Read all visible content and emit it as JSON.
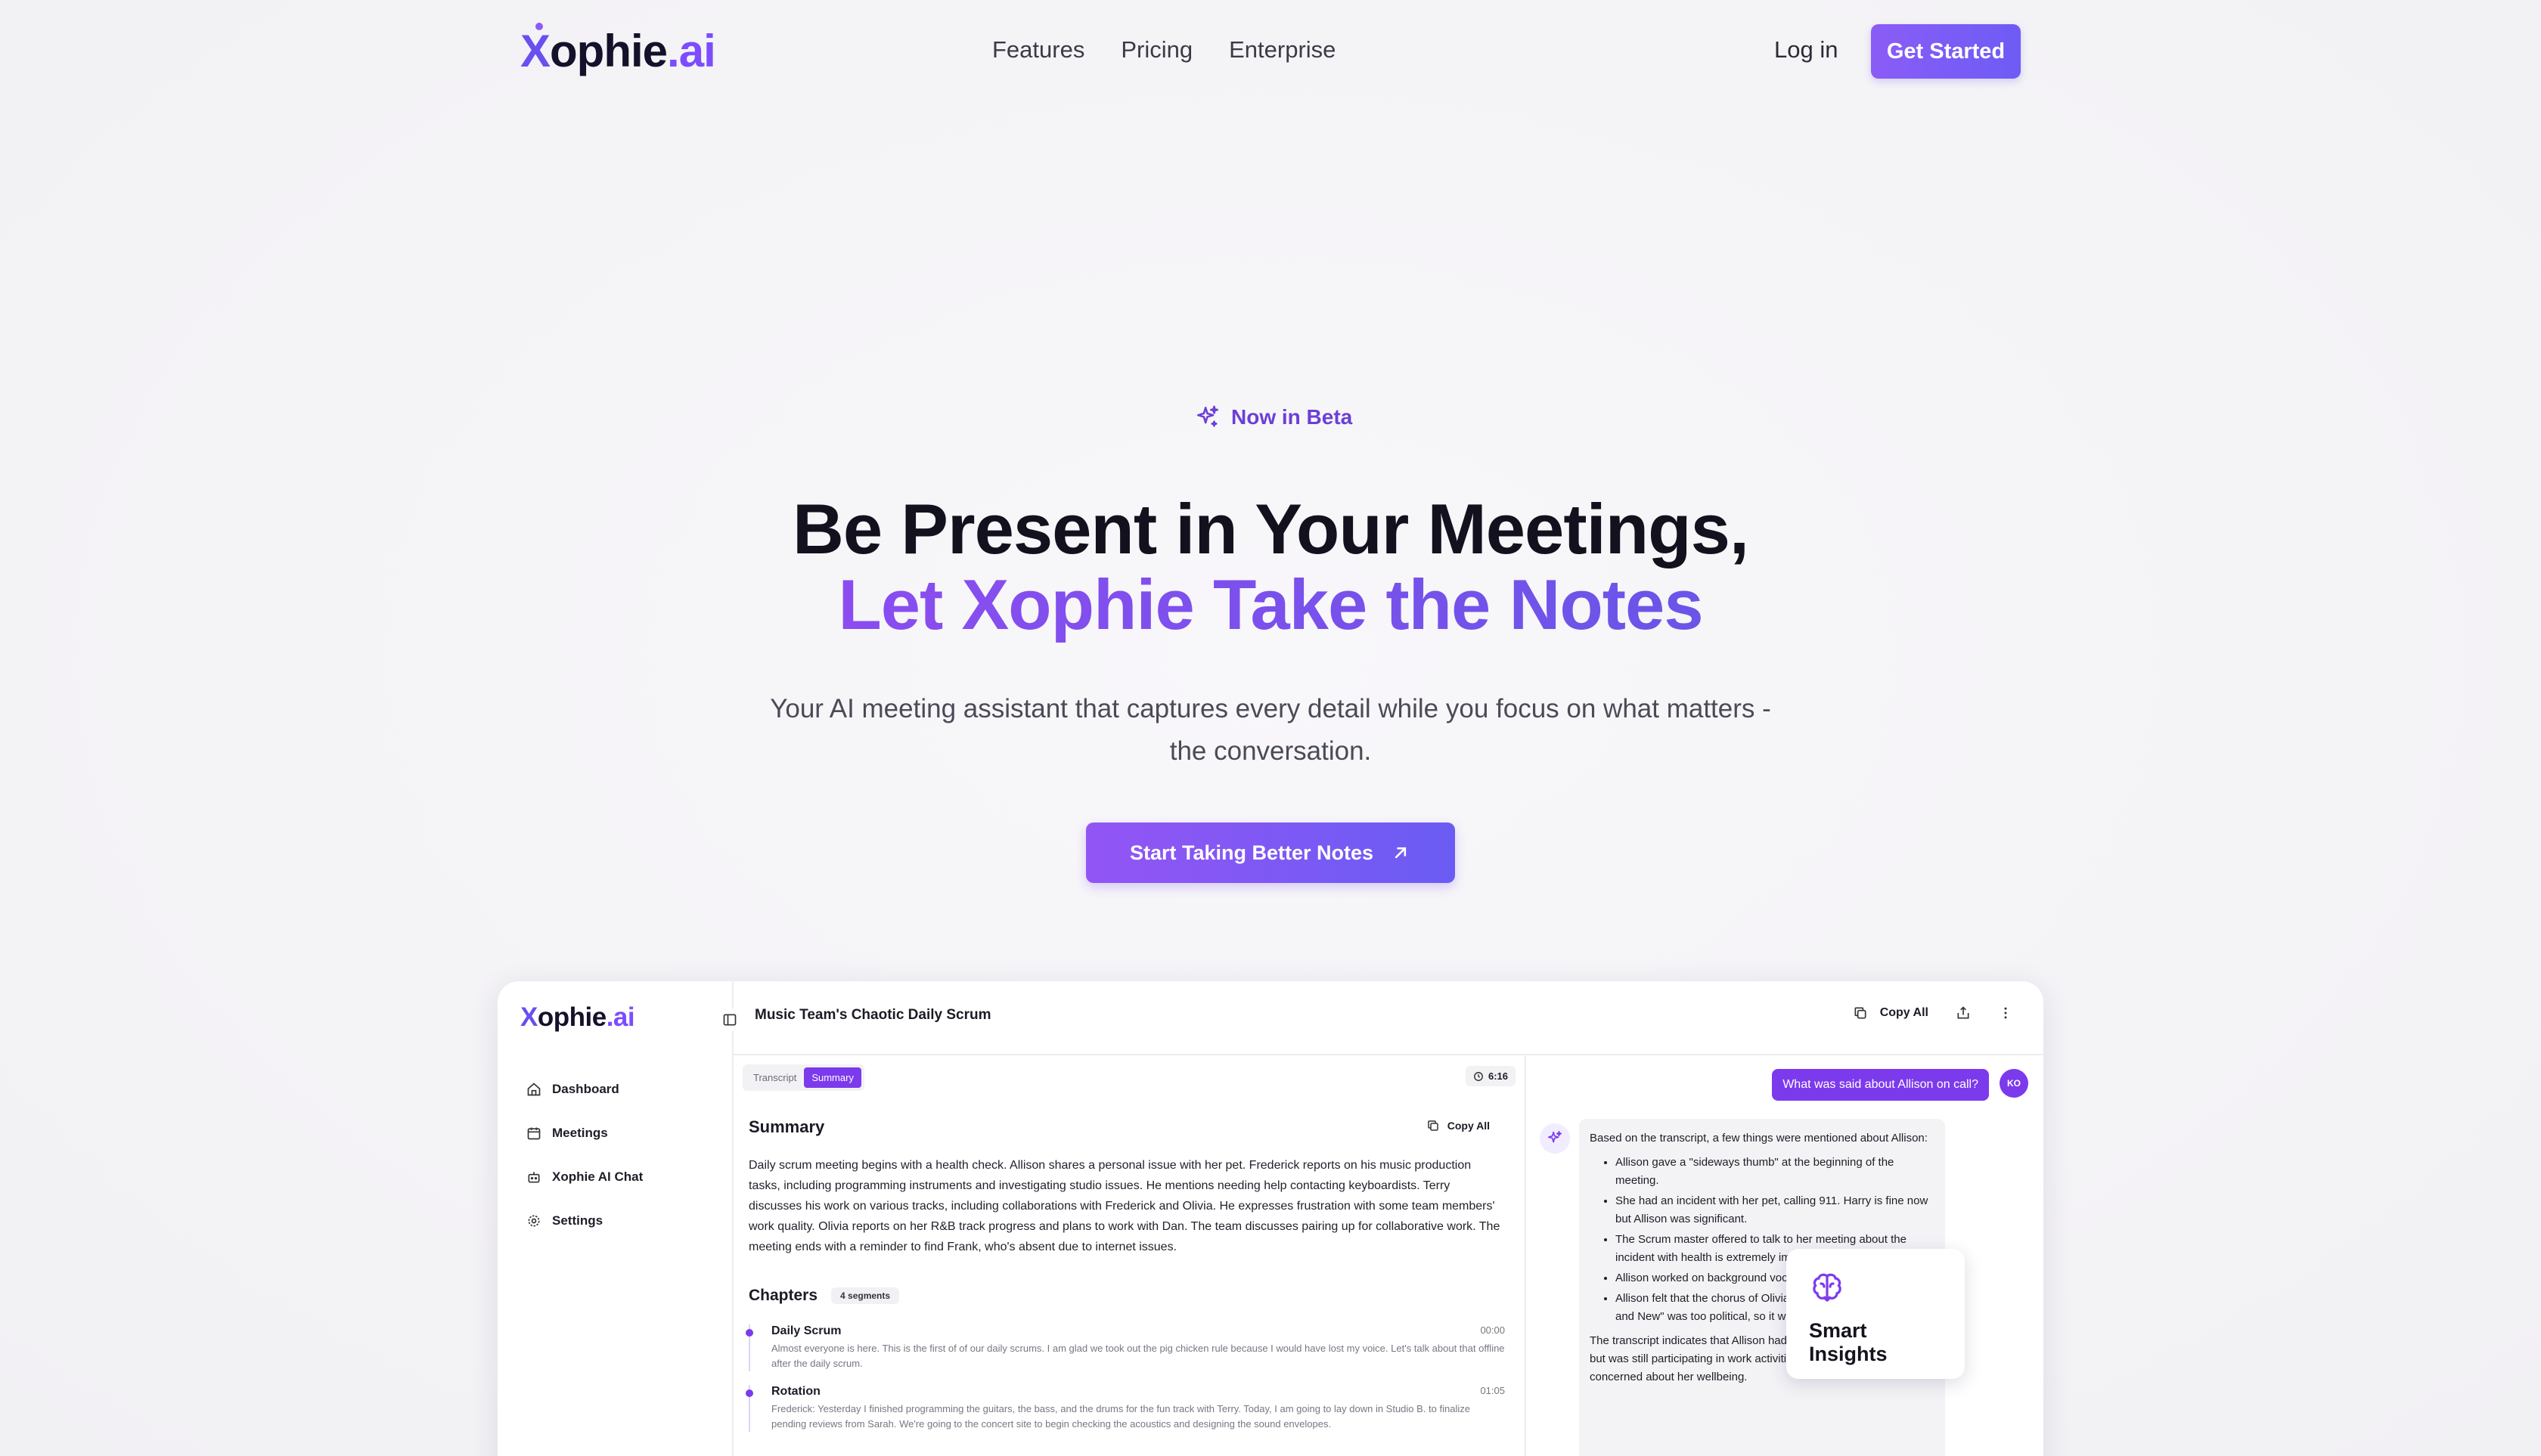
{
  "nav": {
    "logo_x": "X",
    "logo_rest": "ophie",
    "logo_dot": ".ai",
    "links": [
      "Features",
      "Pricing",
      "Enterprise"
    ],
    "login": "Log in",
    "cta": "Get Started"
  },
  "hero": {
    "badge": "Now in Beta",
    "title_line1": "Be Present in Your Meetings,",
    "title_line2": "Let Xophie Take the Notes",
    "subtitle": "Your AI meeting assistant that captures every detail while you focus on what matters - the conversation.",
    "cta": "Start Taking Better Notes"
  },
  "app": {
    "logo_x": "X",
    "logo_rest": "ophie",
    "logo_dot": ".ai",
    "sidebar": [
      "Dashboard",
      "Meetings",
      "Xophie AI Chat",
      "Settings"
    ],
    "meeting_title": "Music Team's Chaotic Daily Scrum",
    "copy_all": "Copy All",
    "tabs": [
      "Transcript",
      "Summary"
    ],
    "active_tab": "Summary",
    "duration": "6:16",
    "summary_title": "Summary",
    "summary_copy": "Copy All",
    "summary_text": "Daily scrum meeting begins with a health check. Allison shares a personal issue with her pet. Frederick reports on his music production tasks, including programming instruments and investigating studio issues. He mentions needing help contacting keyboardists. Terry discusses his work on various tracks, including collaborations with Frederick and Olivia. He expresses frustration with some team members' work quality. Olivia reports on her R&B track progress and plans to work with Dan. The team discusses pairing up for collaborative work. The meeting ends with a reminder to find Frank, who's absent due to internet issues.",
    "chapters_title": "Chapters",
    "chapters_badge": "4 segments",
    "chapters": [
      {
        "name": "Daily Scrum",
        "time": "00:00",
        "text": "Almost everyone is here. This is the first of of our daily scrums. I am glad we took out the pig chicken rule because I would have lost my voice. Let's talk about that offline after the daily scrum."
      },
      {
        "name": "Rotation",
        "time": "01:05",
        "text": "Frederick: Yesterday I finished programming the guitars, the bass, and the drums for the fun track with Terry. Today, I am going to lay down in Studio B. to finalize pending reviews from Sarah. We're going to the concert site to begin checking the acoustics and designing the sound envelopes."
      }
    ],
    "chat": {
      "question": "What was said about Allison on call?",
      "avatar": "KO",
      "intro": "Based on the transcript, a few things were mentioned about Allison:",
      "bullets": [
        "Allison gave a \"sideways thumb\" at the beginning of the meeting.",
        "She had an incident with her pet, calling 911. Harry is fine now but Allison was significant.",
        "The Scrum master offered to talk to her meeting about the incident with health is extremely important to the team.",
        "Allison worked on background vocals with Olivia.",
        "Allison felt that the chorus of Olivia's R&B track \"Red, White and New\" was too political, so it was rewritten."
      ],
      "outro": "The transcript indicates that Allison had a difficult personal situation but was still participating in work activities. The team seemed concerned about her wellbeing."
    },
    "insight_label": "Smart Insights"
  }
}
